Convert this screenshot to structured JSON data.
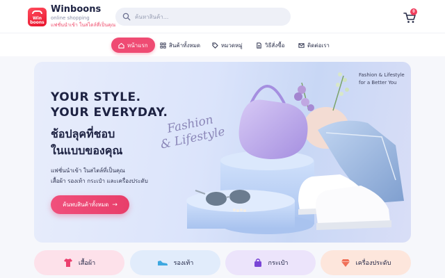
{
  "brand": {
    "logo_text": "Win boons",
    "name": "Winboons",
    "subtitle": "online shopping",
    "tagline": "แฟชั่นนำเข้า ในสไตล์ที่เป็นคุณ"
  },
  "search": {
    "placeholder": "ค้นหาสินค้า..."
  },
  "cart": {
    "count": "0",
    "icon": "cart-icon"
  },
  "nav": {
    "items": [
      {
        "label": "หน้าแรก",
        "icon": "home-icon",
        "active": true
      },
      {
        "label": "สินค้าทั้งหมด",
        "icon": "grid-icon",
        "active": false
      },
      {
        "label": "หมวดหมู่",
        "icon": "tag-icon",
        "active": false
      },
      {
        "label": "วิธีสั่งซื้อ",
        "icon": "document-icon",
        "active": false
      },
      {
        "label": "ติดต่อเรา",
        "icon": "mail-icon",
        "active": false
      }
    ]
  },
  "hero": {
    "headline_1": "YOUR STYLE.",
    "headline_2": "YOUR EVERYDAY.",
    "thai_1": "ช้อปลุคที่ชอบ",
    "thai_2": "ในแบบของคุณ",
    "desc_1": "แฟชั่นนำเข้า ในสไตล์ที่เป็นคุณ",
    "desc_2": "เสื้อผ้า รองเท้า กระเป๋า และเครื่องประดับ",
    "cta": "ค้นพบสินค้าทั้งหมด",
    "script_1": "Fashion",
    "script_2": "& Lifestyle",
    "corner_1": "Fashion & Lifestyle",
    "corner_2": "for a Better You"
  },
  "categories": [
    {
      "label": "เสื้อผ้า",
      "icon": "shirt-icon",
      "color": "#fde1ea"
    },
    {
      "label": "รองเท้า",
      "icon": "sneaker-icon",
      "color": "#e1ecfb"
    },
    {
      "label": "กระเป๋า",
      "icon": "bag-icon",
      "color": "#ece4fb"
    },
    {
      "label": "เครื่องประดับ",
      "icon": "gem-icon",
      "color": "#fde6dc"
    }
  ],
  "colors": {
    "accent": "#ef4b73",
    "text": "#1d2242"
  }
}
